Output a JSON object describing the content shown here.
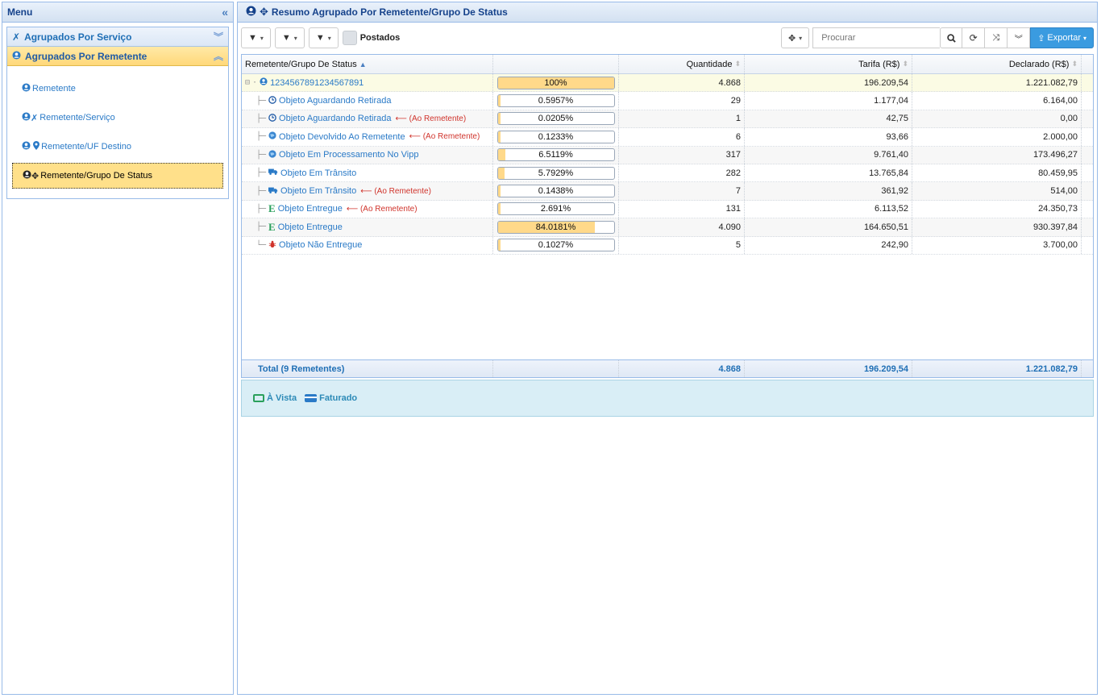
{
  "menu": {
    "title": "Menu",
    "sections": [
      {
        "label": "Agrupados Por Serviço",
        "active": false
      },
      {
        "label": "Agrupados Por Remetente",
        "active": true
      }
    ],
    "items": [
      {
        "label": "Remetente"
      },
      {
        "label": "Remetente/Serviço"
      },
      {
        "label": "Remetente/UF Destino"
      },
      {
        "label": "Remetente/Grupo De Status",
        "selected": true
      }
    ]
  },
  "main": {
    "title": "Resumo Agrupado Por Remetente/Grupo De Status"
  },
  "toolbar": {
    "postados_label": "Postados",
    "search_placeholder": "Procurar",
    "export_label": "Exportar"
  },
  "grid": {
    "headers": [
      "Remetente/Grupo De Status",
      "",
      "Quantidade",
      "Tarifa (R$)",
      "Declarado (R$)"
    ],
    "rows": [
      {
        "label": "1234567891234567891",
        "ao": "",
        "pct_text": "100%",
        "pct": 100,
        "qtd": "4.868",
        "tarifa": "196.209,54",
        "declarado": "1.221.082,79",
        "icon": "user-icon",
        "root": true
      },
      {
        "label": "Objeto Aguardando Retirada",
        "ao": "",
        "pct_text": "0.5957%",
        "pct": 0.5957,
        "qtd": "29",
        "tarifa": "1.177,04",
        "declarado": "6.164,00",
        "icon": "clock-icon"
      },
      {
        "label": "Objeto Aguardando Retirada",
        "ao": "(Ao Remetente)",
        "pct_text": "0.0205%",
        "pct": 0.0205,
        "qtd": "1",
        "tarifa": "42,75",
        "declarado": "0,00",
        "icon": "clock-icon"
      },
      {
        "label": "Objeto Devolvido Ao Remetente",
        "ao": "(Ao Remetente)",
        "pct_text": "0.1233%",
        "pct": 0.1233,
        "qtd": "6",
        "tarifa": "93,66",
        "declarado": "2.000,00",
        "icon": "globe-icon"
      },
      {
        "label": "Objeto Em Processamento No Vipp",
        "ao": "",
        "pct_text": "6.5119%",
        "pct": 6.5119,
        "qtd": "317",
        "tarifa": "9.761,40",
        "declarado": "173.496,27",
        "icon": "globe-icon"
      },
      {
        "label": "Objeto Em Trânsito",
        "ao": "",
        "pct_text": "5.7929%",
        "pct": 5.7929,
        "qtd": "282",
        "tarifa": "13.765,84",
        "declarado": "80.459,95",
        "icon": "truck-icon"
      },
      {
        "label": "Objeto Em Trânsito",
        "ao": "(Ao Remetente)",
        "pct_text": "0.1438%",
        "pct": 0.1438,
        "qtd": "7",
        "tarifa": "361,92",
        "declarado": "514,00",
        "icon": "truck-icon"
      },
      {
        "label": "Objeto Entregue",
        "ao": "(Ao Remetente)",
        "pct_text": "2.691%",
        "pct": 2.691,
        "qtd": "131",
        "tarifa": "6.113,52",
        "declarado": "24.350,73",
        "icon": "delivered-e-icon"
      },
      {
        "label": "Objeto Entregue",
        "ao": "",
        "pct_text": "84.0181%",
        "pct": 84.0181,
        "qtd": "4.090",
        "tarifa": "164.650,51",
        "declarado": "930.397,84",
        "icon": "delivered-e-icon"
      },
      {
        "label": "Objeto Não Entregue",
        "ao": "",
        "pct_text": "0.1027%",
        "pct": 0.1027,
        "qtd": "5",
        "tarifa": "242,90",
        "declarado": "3.700,00",
        "icon": "bug-icon"
      }
    ],
    "footer": {
      "label": "Total (9 Remetentes)",
      "qtd": "4.868",
      "tarifa": "196.209,54",
      "declarado": "1.221.082,79"
    }
  },
  "legend": {
    "a_vista": "À Vista",
    "faturado": "Faturado"
  },
  "colors": {
    "accent": "#2a7ac7",
    "selected": "#ffe08a",
    "progress": "#ffd98a",
    "warning": "#d0342c"
  }
}
